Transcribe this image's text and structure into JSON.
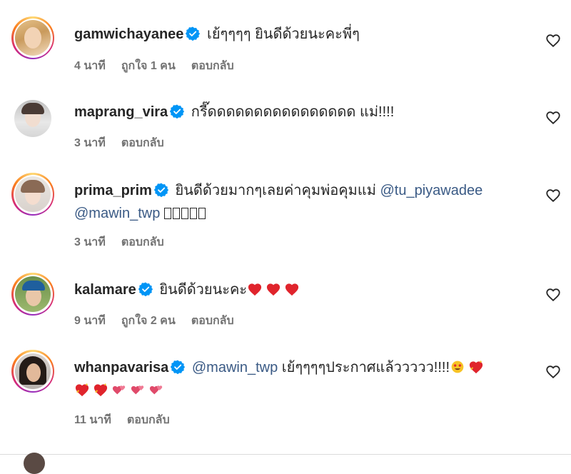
{
  "comments": [
    {
      "username": "gamwichayanee",
      "text": "เย้ๆๆๆๆ ยินดีด้วยนะคะพี่ๆ",
      "time": "4 นาที",
      "likes": "ถูกใจ 1 คน",
      "reply": "ตอบกลับ"
    },
    {
      "username": "maprang_vira",
      "text": "กรี๊ดดดดดดดดดดดดดดดด แม่!!!!",
      "time": "3 นาที",
      "reply": "ตอบกลับ"
    },
    {
      "username": "prima_prim",
      "text": "ยินดีด้วยมากๆเลยค่าคุมพ่อคุมแม่",
      "mention1": "@tu_piyawadee",
      "mention2": "@mawin_twp",
      "time": "3 นาที",
      "reply": "ตอบกลับ"
    },
    {
      "username": "kalamare",
      "text": "ยินดีด้วยนะคะ",
      "time": "9 นาที",
      "likes": "ถูกใจ 2 คน",
      "reply": "ตอบกลับ"
    },
    {
      "username": "whanpavarisa",
      "mention": "@mawin_twp",
      "text": "เย้ๆๆๆๆประกาศแล้ววววว!!!!",
      "time": "11 นาที",
      "reply": "ตอบกลับ"
    }
  ],
  "icons": {
    "verified": "verified-badge-icon",
    "like": "heart-outline-icon"
  },
  "colors": {
    "verified": "#0095f6",
    "mention": "#3a5a85",
    "meta": "#737373",
    "heart": "#e0242c"
  }
}
